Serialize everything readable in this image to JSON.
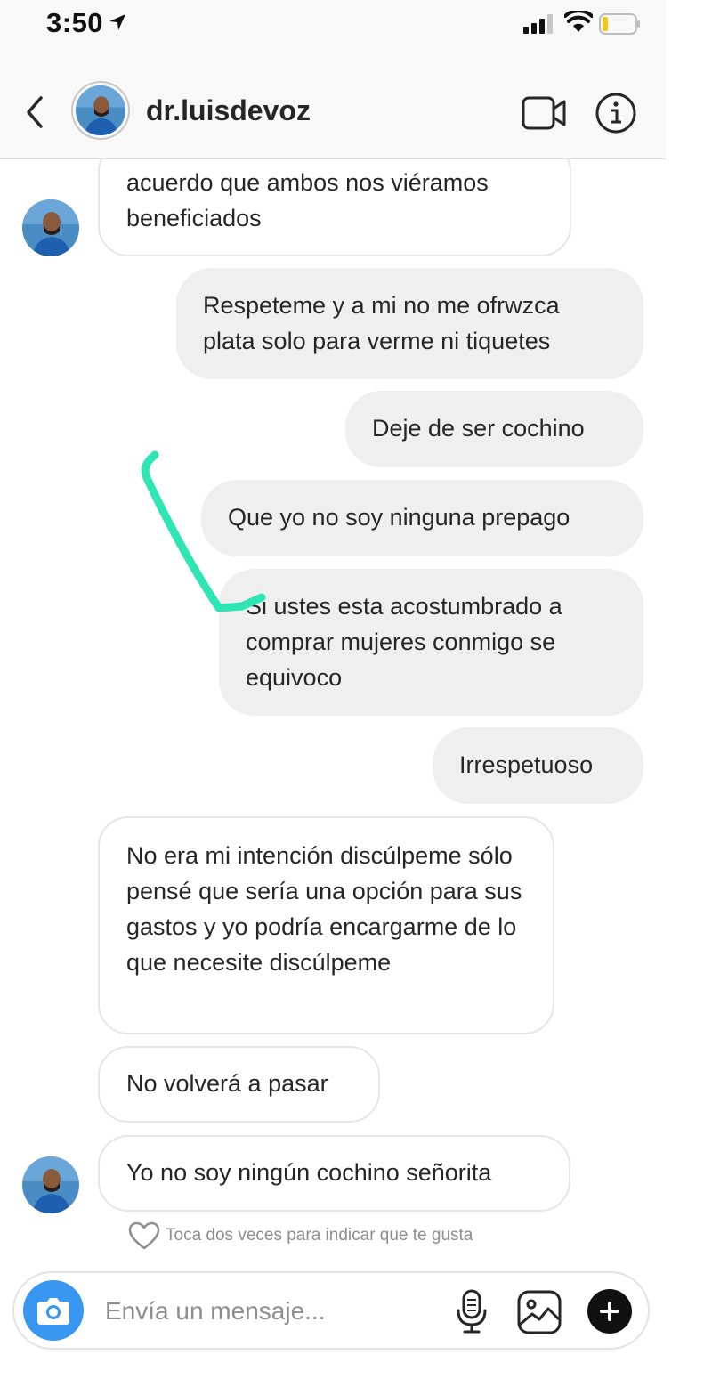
{
  "status_bar": {
    "time": "3:50"
  },
  "header": {
    "username": "dr.luisdevoz"
  },
  "messages": [
    {
      "side": "in",
      "text": "acuerdo que ambos nos viéramos beneficiados"
    },
    {
      "side": "out",
      "text": "Respeteme y a mi no me ofrwzca plata solo para verme ni tiquetes"
    },
    {
      "side": "out",
      "text": "Deje de ser cochino"
    },
    {
      "side": "out",
      "text": "Que yo no soy ninguna prepago"
    },
    {
      "side": "out",
      "text": "Si ustes esta acostumbrado a comprar mujeres conmigo se equivoco"
    },
    {
      "side": "out",
      "text": "Irrespetuoso"
    },
    {
      "side": "in",
      "text": "No era mi intención discúlpeme sólo pensé que sería una opción para sus gastos y yo podría encargarme de lo que necesite discúlpeme"
    },
    {
      "side": "in",
      "text": "No volverá a pasar"
    },
    {
      "side": "in",
      "text": "Yo no soy ningún cochino señorita"
    }
  ],
  "like_hint": "Toca dos veces para indicar que te gusta",
  "composer": {
    "placeholder": "Envía un mensaje..."
  },
  "colors": {
    "accent": "#3897f0",
    "annotation": "#2ee6b4",
    "outgoing_bubble": "#efefef"
  },
  "icons": [
    "location-arrow-icon",
    "signal-icon",
    "wifi-icon",
    "battery-icon",
    "back-chevron-icon",
    "video-call-icon",
    "info-icon",
    "heart-icon",
    "camera-icon",
    "microphone-icon",
    "gallery-icon",
    "plus-icon"
  ]
}
